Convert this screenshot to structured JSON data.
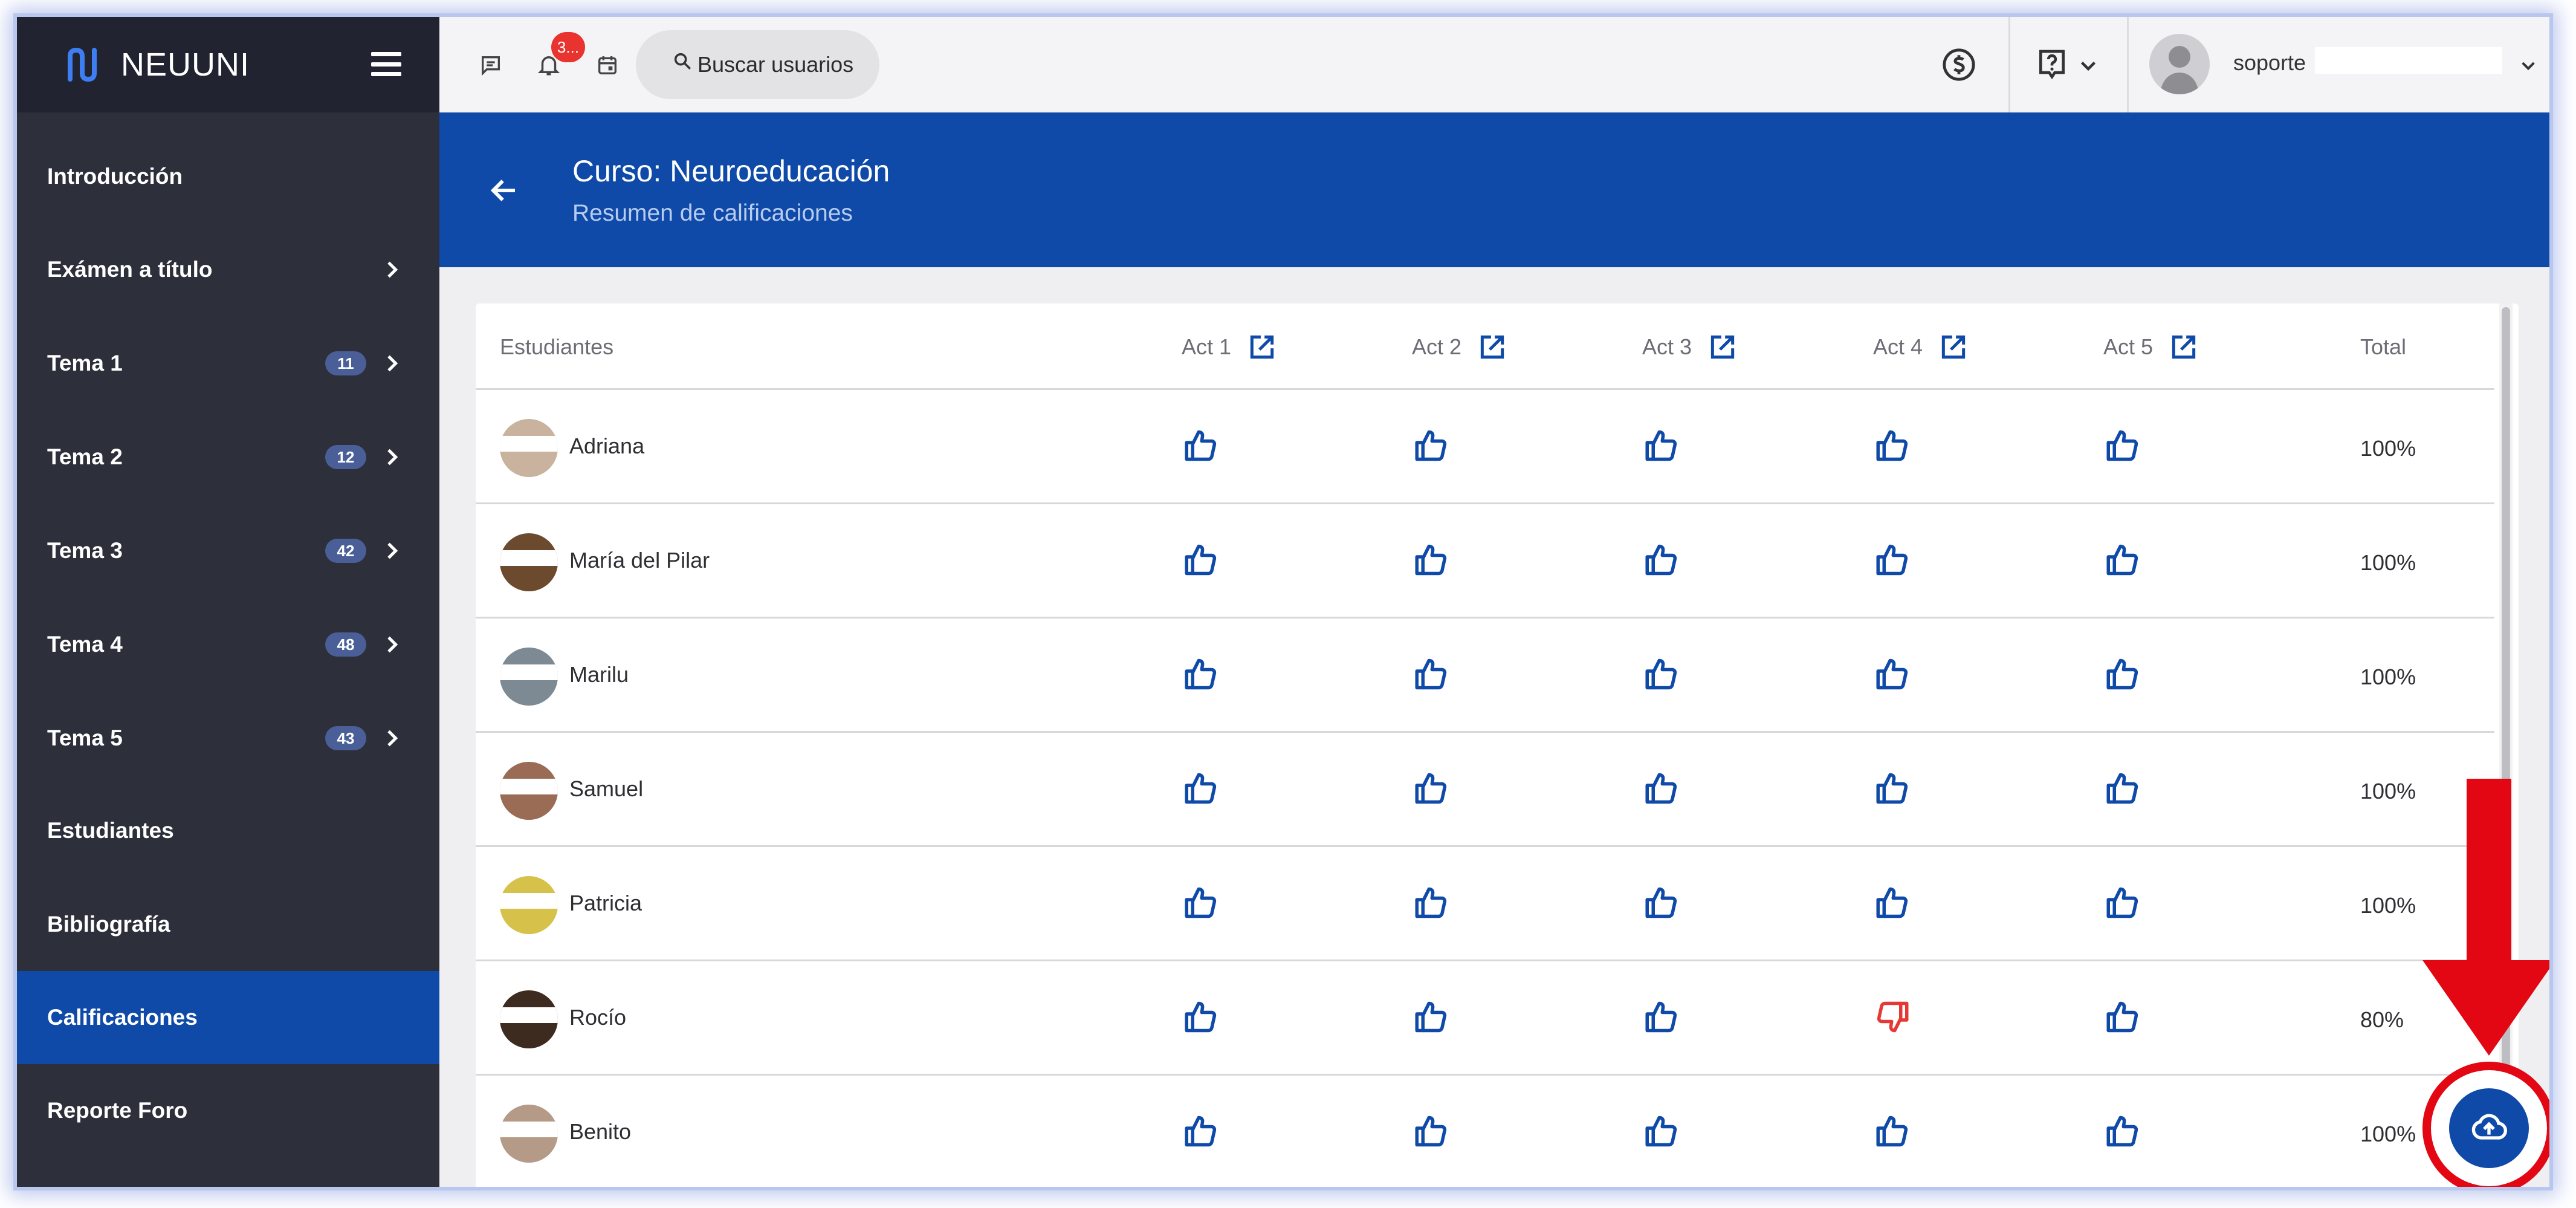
{
  "brand": {
    "name": "NEUUNI"
  },
  "sidebar": {
    "items": [
      {
        "label": "Introducción",
        "badge": null,
        "chevron": false,
        "active": false
      },
      {
        "label": "Exámen a título",
        "badge": null,
        "chevron": true,
        "active": false
      },
      {
        "label": "Tema 1",
        "badge": "11",
        "chevron": true,
        "active": false
      },
      {
        "label": "Tema 2",
        "badge": "12",
        "chevron": true,
        "active": false
      },
      {
        "label": "Tema 3",
        "badge": "42",
        "chevron": true,
        "active": false
      },
      {
        "label": "Tema 4",
        "badge": "48",
        "chevron": true,
        "active": false
      },
      {
        "label": "Tema 5",
        "badge": "43",
        "chevron": true,
        "active": false
      },
      {
        "label": "Estudiantes",
        "badge": null,
        "chevron": false,
        "active": false
      },
      {
        "label": "Bibliografía",
        "badge": null,
        "chevron": false,
        "active": false
      },
      {
        "label": "Calificaciones",
        "badge": null,
        "chevron": false,
        "active": true
      },
      {
        "label": "Reporte Foro",
        "badge": null,
        "chevron": false,
        "active": false
      }
    ]
  },
  "topbar": {
    "notification_count": "3...",
    "search_label": "Buscar usuarios",
    "user_name": "soporte",
    "icons": [
      "chat-icon",
      "bell-icon",
      "calendar-icon",
      "search-icon",
      "dollar-icon",
      "help-icon",
      "chevron-down-icon",
      "avatar",
      "chevron-down-icon"
    ]
  },
  "header": {
    "title": "Curso: Neuroeducación",
    "subtitle": "Resumen de calificaciones"
  },
  "table": {
    "columns": [
      "Estudiantes",
      "Act 1",
      "Act 2",
      "Act 3",
      "Act 4",
      "Act 5",
      "Total"
    ],
    "rows": [
      {
        "name": "Adriana",
        "marks": [
          "up",
          "up",
          "up",
          "up",
          "up"
        ],
        "total": "100%"
      },
      {
        "name": "María del Pilar",
        "marks": [
          "up",
          "up",
          "up",
          "up",
          "up"
        ],
        "total": "100%"
      },
      {
        "name": "Marilu",
        "marks": [
          "up",
          "up",
          "up",
          "up",
          "up"
        ],
        "total": "100%"
      },
      {
        "name": "Samuel",
        "marks": [
          "up",
          "up",
          "up",
          "up",
          "up"
        ],
        "total": "100%"
      },
      {
        "name": "Patricia",
        "marks": [
          "up",
          "up",
          "up",
          "up",
          "up"
        ],
        "total": "100%"
      },
      {
        "name": "Rocío",
        "marks": [
          "up",
          "up",
          "up",
          "down",
          "up"
        ],
        "total": "80%"
      },
      {
        "name": "Benito",
        "marks": [
          "up",
          "up",
          "up",
          "up",
          "up"
        ],
        "total": "100%"
      }
    ]
  },
  "colors": {
    "primary": "#0f4aa8",
    "sidebar": "#2d2f3b",
    "thumb_up": "#0f4aa8",
    "thumb_down": "#e53935",
    "annotation": "#e30613"
  },
  "fab": {
    "icon": "cloud-upload-icon"
  }
}
